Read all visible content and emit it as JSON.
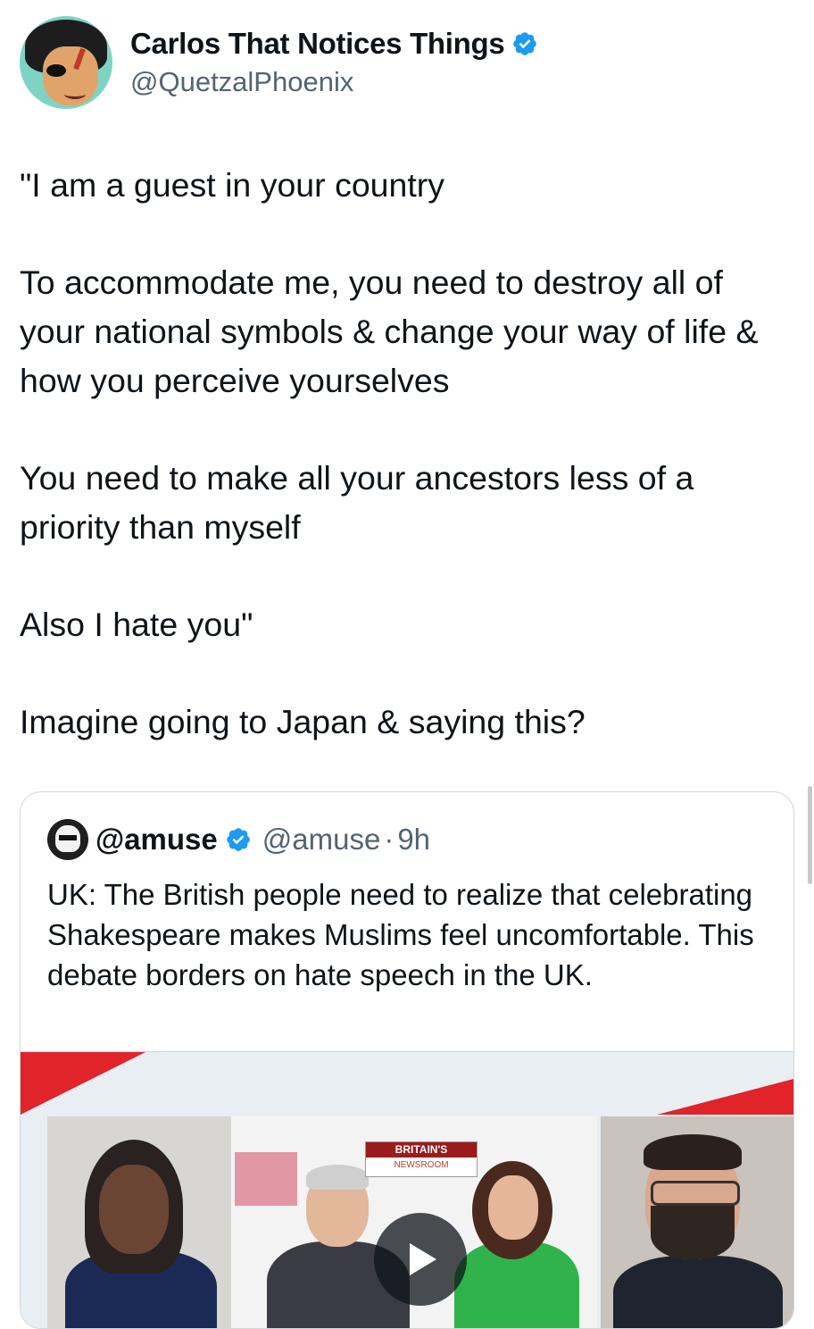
{
  "tweet": {
    "display_name": "Carlos That Notices Things",
    "handle": "@QuetzalPhoenix",
    "paragraphs": [
      "\"I am a guest in your country",
      "To accommodate me, you need to destroy all of your national symbols & change your way of life & how you perceive yourselves",
      "You need to make all your ancestors less of a priority than myself",
      "Also I hate you\"",
      "Imagine going to Japan & saying this?"
    ]
  },
  "quote": {
    "display_name": "@amuse",
    "handle": "@amuse",
    "separator": "·",
    "time": "9h",
    "text": "UK: The British people need to realize that celebrating Shakespeare makes Muslims feel uncomfortable. This debate borders on hate speech in the UK.",
    "media": {
      "logo_line1": "BRITAIN'S",
      "logo_line2": "NEWSROOM",
      "play_icon": "play-icon"
    }
  },
  "colors": {
    "verified_blue": "#1d9bf0",
    "secondary_text": "#536471",
    "border": "#cfd9de"
  }
}
